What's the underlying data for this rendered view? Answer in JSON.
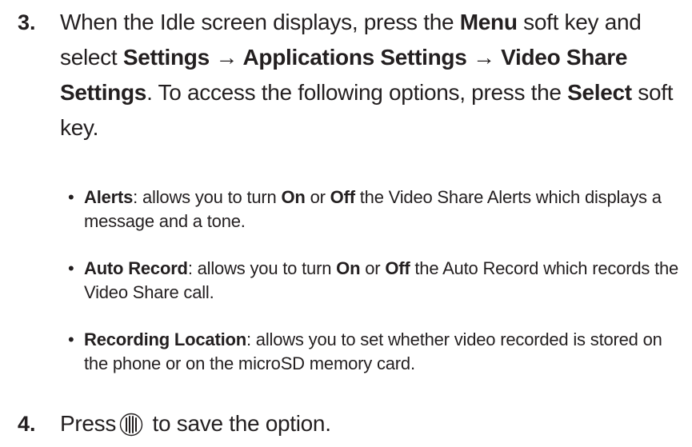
{
  "step3": {
    "number": "3.",
    "t1": "When the Idle screen displays, press the ",
    "menu": "Menu",
    "t2": " soft key and select ",
    "settings": "Settings",
    "arrow1": " → ",
    "app_settings": "Applications Settings",
    "arrow2": " → ",
    "video_share_settings": "Video Share Settings",
    "t3": ". To access the following options, press the ",
    "select": "Select",
    "t4": " soft key."
  },
  "bullets": [
    {
      "term": "Alerts",
      "t1": ": allows you to turn ",
      "on": "On",
      "or": " or ",
      "off": "Off",
      "t2": " the Video Share Alerts which displays a message and a tone."
    },
    {
      "term": "Auto Record",
      "t1": ": allows you to turn ",
      "on": "On",
      "or": " or ",
      "off": "Off",
      "t2": " the Auto Record which records the Video Share call."
    },
    {
      "term": "Recording Location",
      "t1": ": allows you to set whether video recorded is stored on the phone or on the microSD memory card."
    }
  ],
  "step4": {
    "number": "4.",
    "t1": "Press",
    "icon": "side-key-icon",
    "t2": " to save the option."
  }
}
